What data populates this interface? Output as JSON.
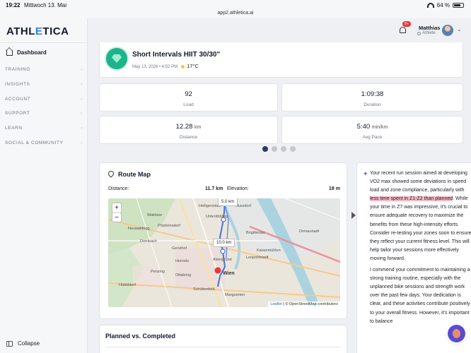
{
  "status_bar": {
    "time": "19:22",
    "date": "Mittwoch 13. Mai",
    "url": "app2.athletica.ai",
    "battery": "64 %"
  },
  "app": {
    "logo_main": "ATHL",
    "logo_accent": "E",
    "logo_rest": "TICA"
  },
  "sidebar": {
    "dashboard": "Dashboard",
    "sections": [
      "TRAINING",
      "INSIGHTS",
      "ACCOUNT",
      "SUPPORT",
      "LEARN",
      "SOCIAL & COMMUNITY"
    ],
    "collapse": "Collapse"
  },
  "header": {
    "notification_count": "9+",
    "user_name": "Matthias",
    "user_role": "Athlete"
  },
  "activity": {
    "title": "Short Intervals HIIT 30/30\"",
    "date": "May 13, 2026 • 4:52 PM",
    "temperature": "17°C"
  },
  "stats": [
    {
      "value": "92",
      "unit": "",
      "label": "Load"
    },
    {
      "value": "1:09:38",
      "unit": "",
      "label": "Duration"
    },
    {
      "value": "12.28",
      "unit": "km",
      "label": "Distance"
    },
    {
      "value": "5:40",
      "unit": "min/km",
      "label": "Avg Pace"
    }
  ],
  "carousel": {
    "total": 4,
    "active": 1
  },
  "route_map": {
    "title": "Route Map",
    "distance_label": "Distance:",
    "distance_value": "11.7 km",
    "elevation_label": "Elevation:",
    "elevation_value": "18 m",
    "marker_5": "5.0 km",
    "marker_10": "10.0 km",
    "zoom_in": "+",
    "zoom_out": "−",
    "attribution_leaflet": "Leaflet",
    "attribution_osm": "| © OpenStreetMap contributors",
    "place_labels": [
      "Heiligenstadt",
      "Unterdöbling",
      "Neuwaldegg",
      "Pötzleinsdorf",
      "Gersthof",
      "Dornbach",
      "Hernals",
      "Ottakring",
      "Penzing",
      "Alsergrund",
      "Hütteldorf",
      "Wien",
      "Leopoldstadt",
      "Brigittenau",
      "Kaisermühlen",
      "Donaustadt",
      "Schüttenfeld",
      "Margareten",
      "Nussdorf",
      "Waldsee"
    ]
  },
  "ai_insight": {
    "p1_a": "Your recent run session aimed at developing VO2 max showed some deviations in speed load and zone compliance, particularly with ",
    "p1_highlight": "less time spent in Z1-Z2 than planned",
    "p1_b": ". While your time in Z7 was impressive, it's crucial to ensure adequate recovery to maximize the benefits from these high-intensity efforts. Consider re-testing your zones soon to ensure they reflect your current fitness level. This will help tailor your sessions more effectively moving forward.",
    "p2": "I commend your commitment to maintaining a strong training routine, especially with the unplanned bike sessions and strength work over the past few days. Your dedication is clear, and these activities contribute positively to your overall fitness. However, it's important to balance"
  },
  "planned": {
    "title": "Planned vs. Completed"
  }
}
